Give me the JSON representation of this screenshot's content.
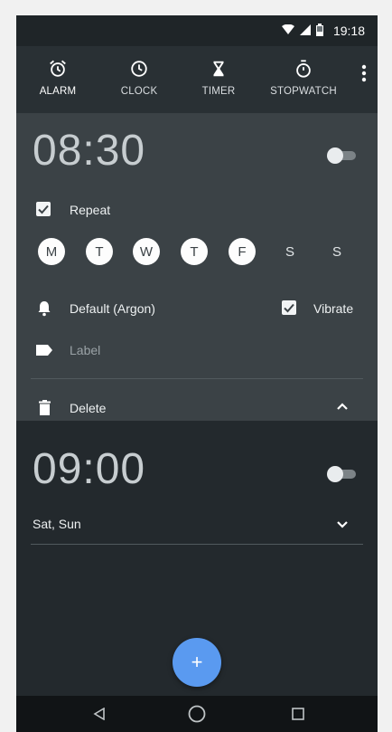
{
  "status_bar": {
    "time": "19:18"
  },
  "tabs": [
    {
      "label": "ALARM",
      "icon": "alarm-icon"
    },
    {
      "label": "CLOCK",
      "icon": "clock-icon"
    },
    {
      "label": "TIMER",
      "icon": "hourglass-icon"
    },
    {
      "label": "STOPWATCH",
      "icon": "stopwatch-icon"
    }
  ],
  "alarms": [
    {
      "time": "08:30",
      "enabled": false,
      "repeat_label": "Repeat",
      "repeat_checked": true,
      "days": [
        {
          "letter": "M",
          "on": true
        },
        {
          "letter": "T",
          "on": true
        },
        {
          "letter": "W",
          "on": true
        },
        {
          "letter": "T",
          "on": true
        },
        {
          "letter": "F",
          "on": true
        },
        {
          "letter": "S",
          "on": false
        },
        {
          "letter": "S",
          "on": false
        }
      ],
      "ringtone": "Default (Argon)",
      "vibrate_label": "Vibrate",
      "vibrate_checked": true,
      "label_placeholder": "Label",
      "delete_label": "Delete"
    },
    {
      "time": "09:00",
      "enabled": false,
      "summary": "Sat, Sun"
    }
  ],
  "fab": {
    "label": "+"
  },
  "colors": {
    "accent": "#5a9af0",
    "expanded_card": "#3b4246",
    "background": "#23292d"
  }
}
